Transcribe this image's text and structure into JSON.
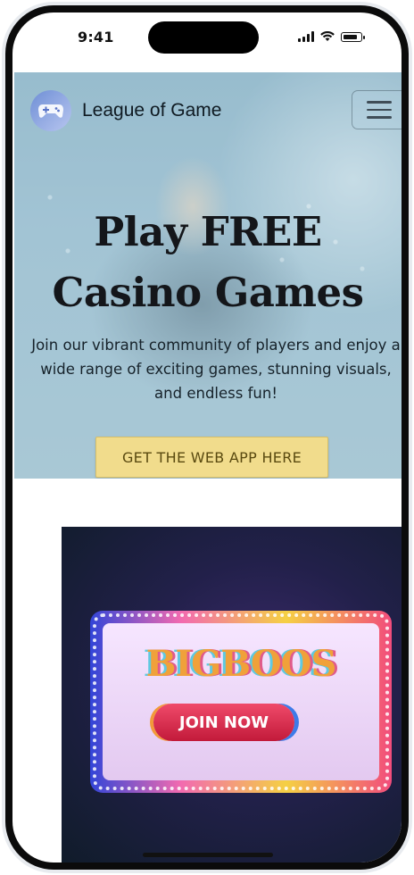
{
  "status_bar": {
    "time": "9:41"
  },
  "header": {
    "brand_name": "League of Game",
    "logo_icon": "gamepad-icon",
    "menu_icon": "hamburger-menu-icon"
  },
  "hero": {
    "title": "Play FREE Casino Games",
    "subtitle": "Join our vibrant community of players and enjoy a wide range of exciting games, stunning visuals, and endless fun!",
    "cta_label": "GET THE WEB APP HERE"
  },
  "promo": {
    "title": "BIGBOOS",
    "button_label": "JOIN NOW"
  }
}
